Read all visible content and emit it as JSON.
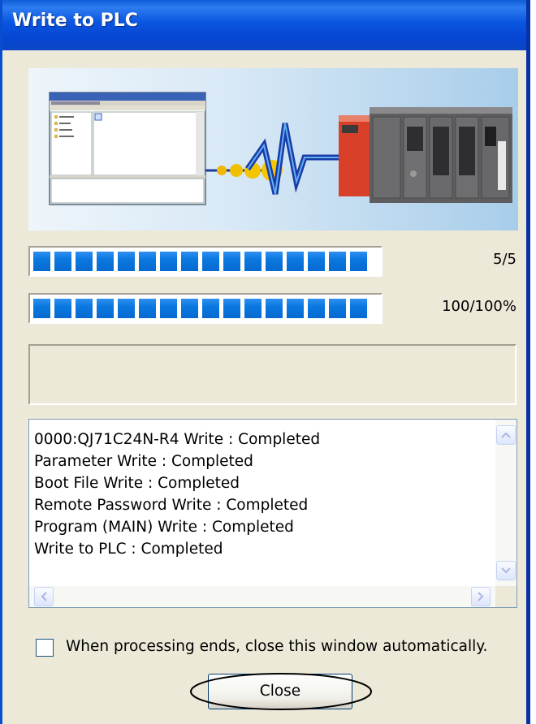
{
  "window": {
    "title": "Write to PLC"
  },
  "progress": {
    "items": {
      "fraction": 1.0,
      "label": "5/5"
    },
    "percent": {
      "fraction": 1.0,
      "label": "100/100%"
    }
  },
  "status_text": "",
  "log": {
    "lines": [
      "0000:QJ71C24N-R4 Write : Completed",
      "Parameter Write : Completed",
      "Boot File Write : Completed",
      "Remote Password Write : Completed",
      "Program (MAIN) Write : Completed",
      "Write to PLC : Completed"
    ]
  },
  "options": {
    "auto_close_label": "When processing ends, close this window automatically.",
    "auto_close_checked": false
  },
  "buttons": {
    "close_label": "Close"
  },
  "icons": {
    "scroll_up": "chevron-up-icon",
    "scroll_down": "chevron-down-icon",
    "scroll_left": "chevron-left-icon",
    "scroll_right": "chevron-right-icon"
  },
  "colors": {
    "titlebar": "#0a55e0",
    "progress_fill": "#0a78e0",
    "dialog_bg": "#ece9d8",
    "plc_module": "#e0442a"
  }
}
